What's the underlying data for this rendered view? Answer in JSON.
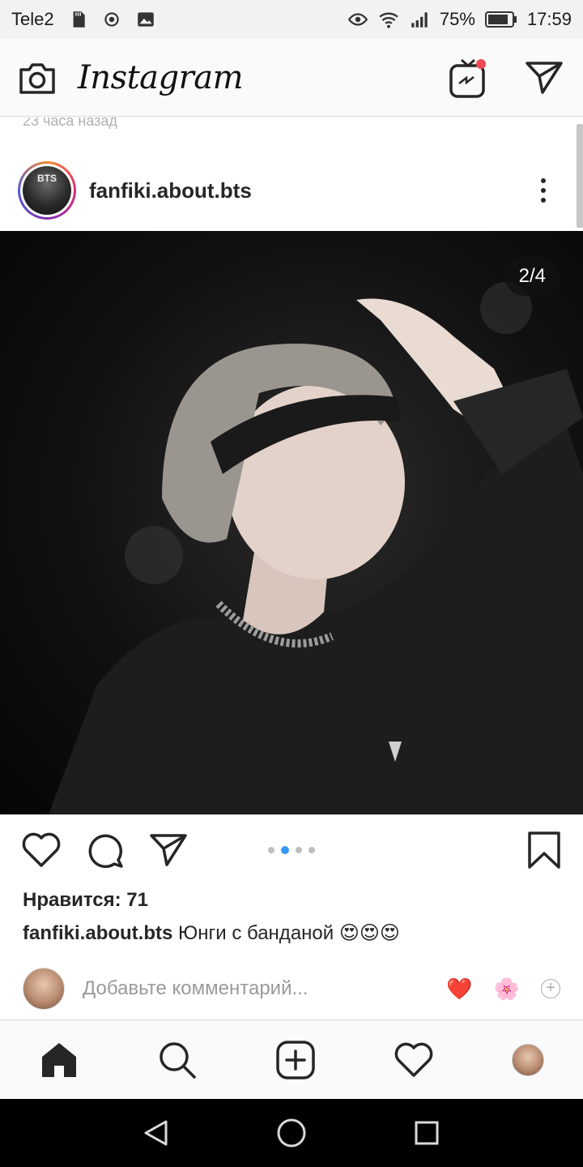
{
  "status_bar": {
    "carrier": "Tele2",
    "battery": "75%",
    "time": "17:59"
  },
  "app": {
    "title": "Instagram"
  },
  "feed": {
    "prev_post_time": "23 часа назад"
  },
  "post": {
    "username": "fanfiki.about.bts",
    "avatar_text": "BTS",
    "image_counter": "2/4",
    "carousel": {
      "count": 4,
      "active_index": 1
    },
    "likes": "Нравится: 71",
    "caption_user": "fanfiki.about.bts",
    "caption_text": "Юнги с банданой 😍😍😍"
  },
  "comment": {
    "placeholder": "Добавьте комментарий...",
    "quick_reactions": [
      "❤️",
      "🌸"
    ]
  },
  "colors": {
    "accent_blue": "#3897f0",
    "notification_red": "#ed4956"
  }
}
